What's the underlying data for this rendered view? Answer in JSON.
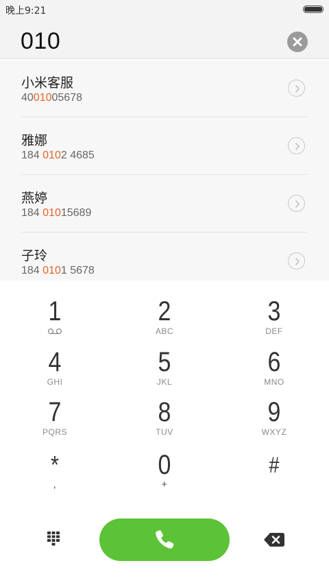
{
  "status_bar": {
    "time": "晚上9:21",
    "battery_icon": "battery-icon",
    "battery_level": 1.0
  },
  "number_bar": {
    "number": "010",
    "clear_icon": "clear-icon"
  },
  "contacts": [
    {
      "name": "小米客服",
      "number_parts": [
        "40",
        "010",
        "05678"
      ]
    },
    {
      "name": "雅娜",
      "number_parts": [
        "184 ",
        "010",
        "2 4685"
      ]
    },
    {
      "name": "燕婷",
      "number_parts": [
        "184 ",
        "010",
        "15689"
      ]
    },
    {
      "name": "子玲",
      "number_parts": [
        "184 ",
        "010",
        "1 5678"
      ]
    }
  ],
  "dialpad": {
    "keys": [
      {
        "digit": "1",
        "letters": ""
      },
      {
        "digit": "2",
        "letters": "ABC"
      },
      {
        "digit": "3",
        "letters": "DEF"
      },
      {
        "digit": "4",
        "letters": "GHI"
      },
      {
        "digit": "5",
        "letters": "JKL"
      },
      {
        "digit": "6",
        "letters": "MNO"
      },
      {
        "digit": "7",
        "letters": "PQRS"
      },
      {
        "digit": "8",
        "letters": "TUV"
      },
      {
        "digit": "9",
        "letters": "WXYZ"
      },
      {
        "digit": "*",
        "letters": ","
      },
      {
        "digit": "0",
        "letters": "+"
      },
      {
        "digit": "#",
        "letters": ""
      }
    ],
    "voicemail_icon": "voicemail-icon"
  },
  "bottom_bar": {
    "dialpad_icon": "dialpad-grid-icon",
    "call_icon": "phone-icon",
    "backspace_icon": "backspace-icon"
  },
  "colors": {
    "accent_green": "#5cc236",
    "highlight_orange": "#e8632a"
  }
}
